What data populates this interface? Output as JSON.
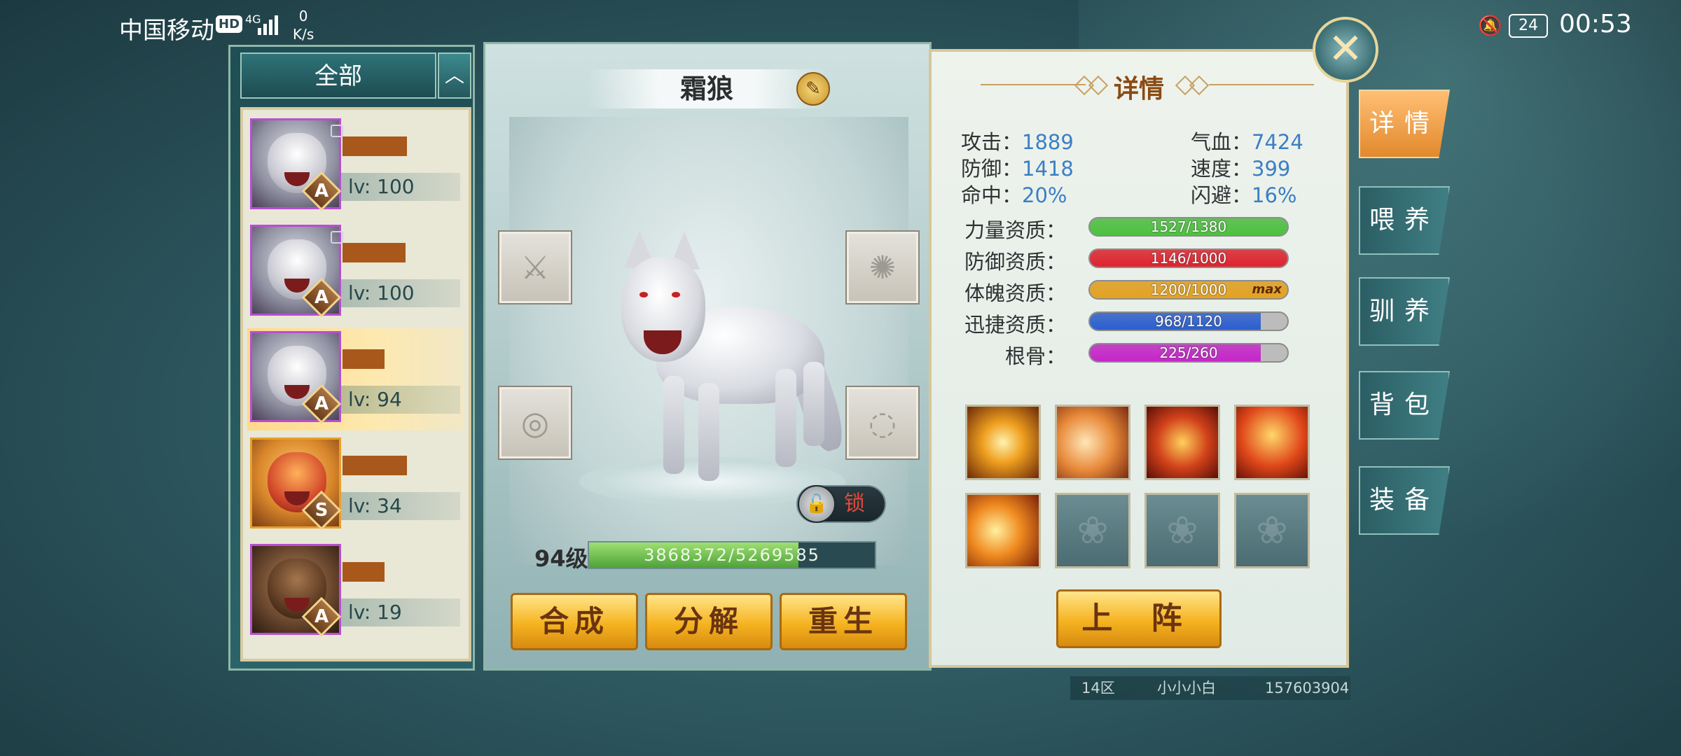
{
  "status_bar": {
    "carrier": "中国移动",
    "hd": "HD",
    "network": "4G",
    "speed_value": "0",
    "speed_unit": "K/s",
    "battery": "24",
    "time": "00:53"
  },
  "pet_list": {
    "filter_label": "全部",
    "items": [
      {
        "level": "lv: 100",
        "grade": "A",
        "locked": true,
        "selected": false
      },
      {
        "level": "lv: 100",
        "grade": "A",
        "locked": true,
        "selected": false
      },
      {
        "level": "lv: 94",
        "grade": "A",
        "locked": false,
        "selected": true
      },
      {
        "level": "lv: 34",
        "grade": "S",
        "locked": false,
        "selected": false
      },
      {
        "level": "lv: 19",
        "grade": "A",
        "locked": false,
        "selected": false
      }
    ]
  },
  "pet": {
    "name": "霜狼",
    "lock_label": "锁",
    "level_label": "94级",
    "exp_text": "3868372/5269585",
    "exp_fraction": 0.734
  },
  "actions": {
    "synth": "合成",
    "decompose": "分解",
    "rebirth": "重生"
  },
  "details": {
    "title": "详情",
    "stats": [
      {
        "label": "攻击：",
        "value": "1889"
      },
      {
        "label": "气血：",
        "value": "7424"
      },
      {
        "label": "防御：",
        "value": "1418"
      },
      {
        "label": "速度：",
        "value": "399"
      },
      {
        "label": "命中：",
        "value": "20%"
      },
      {
        "label": "闪避：",
        "value": "16%"
      }
    ],
    "qualities": [
      {
        "label": "力量资质：",
        "text": "1527/1380",
        "fraction": 1.0,
        "color": "#4cc23e"
      },
      {
        "label": "防御资质：",
        "text": "1146/1000",
        "fraction": 1.0,
        "color": "#e0232d"
      },
      {
        "label": "体魄资质：",
        "text": "1200/1000",
        "fraction": 1.0,
        "color": "#e5a21e",
        "tag": "max"
      },
      {
        "label": "迅捷资质：",
        "text": "968/1120",
        "fraction": 0.864,
        "color": "#2b5fd0"
      },
      {
        "label": "根骨：",
        "text": "225/260",
        "fraction": 0.865,
        "color": "#c625c9"
      }
    ],
    "deploy_label": "上 阵"
  },
  "side_tabs": [
    "详情",
    "喂养",
    "驯养",
    "背包",
    "装备"
  ],
  "footer": {
    "server": "14区",
    "player": "小小小白",
    "id": "157603904"
  },
  "colors": {
    "accent_gold": "#f5b320",
    "stat_value_blue": "#3b7fc4",
    "active_tab": "#e2892d"
  }
}
